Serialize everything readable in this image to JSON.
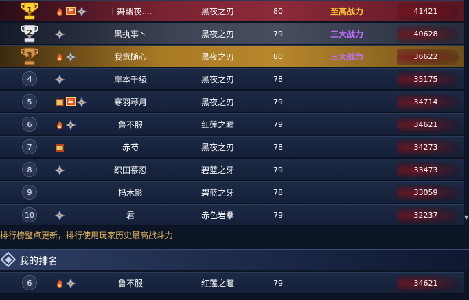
{
  "rows": [
    {
      "rank": "1",
      "name": "丨舞幽夜....",
      "guild": "黑夜之刃",
      "level": "80",
      "title": "至高战力",
      "power": "41421",
      "tags": [
        "fire",
        "nian",
        "shuriken"
      ]
    },
    {
      "rank": "2",
      "name": "黑执事丶",
      "guild": "黑夜之刃",
      "level": "79",
      "title": "三大战力",
      "power": "40628",
      "tags": [
        "shuriken"
      ]
    },
    {
      "rank": "3",
      "name": "我意随心",
      "guild": "黑夜之刃",
      "level": "80",
      "title": "三大战力",
      "power": "36622",
      "tags": [
        "fire",
        "shuriken"
      ]
    },
    {
      "rank": "4",
      "name": "岸本千绫",
      "guild": "黑夜之刃",
      "level": "78",
      "title": "",
      "power": "35175",
      "tags": [
        "shuriken"
      ]
    },
    {
      "rank": "5",
      "name": "寒羽琴月",
      "guild": "黑夜之刃",
      "level": "79",
      "title": "",
      "power": "34714",
      "tags": [
        "scroll",
        "nian",
        "shuriken"
      ]
    },
    {
      "rank": "6",
      "name": "鲁不服",
      "guild": "红莲之瞳",
      "level": "79",
      "title": "",
      "power": "34621",
      "tags": [
        "fire",
        "shuriken"
      ]
    },
    {
      "rank": "7",
      "name": "赤芍",
      "guild": "黑夜之刃",
      "level": "78",
      "title": "",
      "power": "34273",
      "tags": [
        "scroll"
      ]
    },
    {
      "rank": "8",
      "name": "织田慕忍",
      "guild": "碧蓝之牙",
      "level": "79",
      "title": "",
      "power": "33473",
      "tags": [
        "shuriken"
      ]
    },
    {
      "rank": "9",
      "name": "杩木影",
      "guild": "碧蓝之牙",
      "level": "78",
      "title": "",
      "power": "33059",
      "tags": []
    },
    {
      "rank": "10",
      "name": "君",
      "guild": "赤色岩拳",
      "level": "79",
      "title": "",
      "power": "32237",
      "tags": [
        "shuriken"
      ]
    }
  ],
  "tag_labels": {
    "nian": "年"
  },
  "notice": "排行榜整点更新，排行使用玩家历史最高战斗力",
  "my_rank": {
    "header": "我的排名",
    "rank": "6",
    "name": "鲁不服",
    "guild": "红莲之瞳",
    "level": "79",
    "power": "34621",
    "tags": [
      "fire",
      "shuriken"
    ]
  },
  "colors": {
    "gold_title": "#ffc733",
    "purple_title": "#c070ff",
    "notice": "#e3b45b"
  }
}
